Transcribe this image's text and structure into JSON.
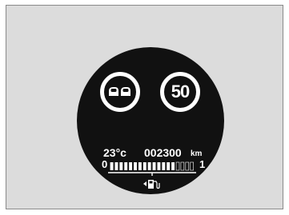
{
  "display": {
    "speed_limit": "50",
    "temperature": "23°c",
    "odometer": "002300",
    "odometer_unit": "km",
    "fuel_scale_min": "0",
    "fuel_scale_max": "1",
    "fuel_level": 0.75,
    "fuel_segments": 18
  },
  "icons": {
    "overtaking": "no-overtaking-sign-icon",
    "fuel": "fuel-pump-icon"
  },
  "colors": {
    "background": "#dcdcdc",
    "dial": "#111111",
    "foreground": "#ffffff"
  }
}
